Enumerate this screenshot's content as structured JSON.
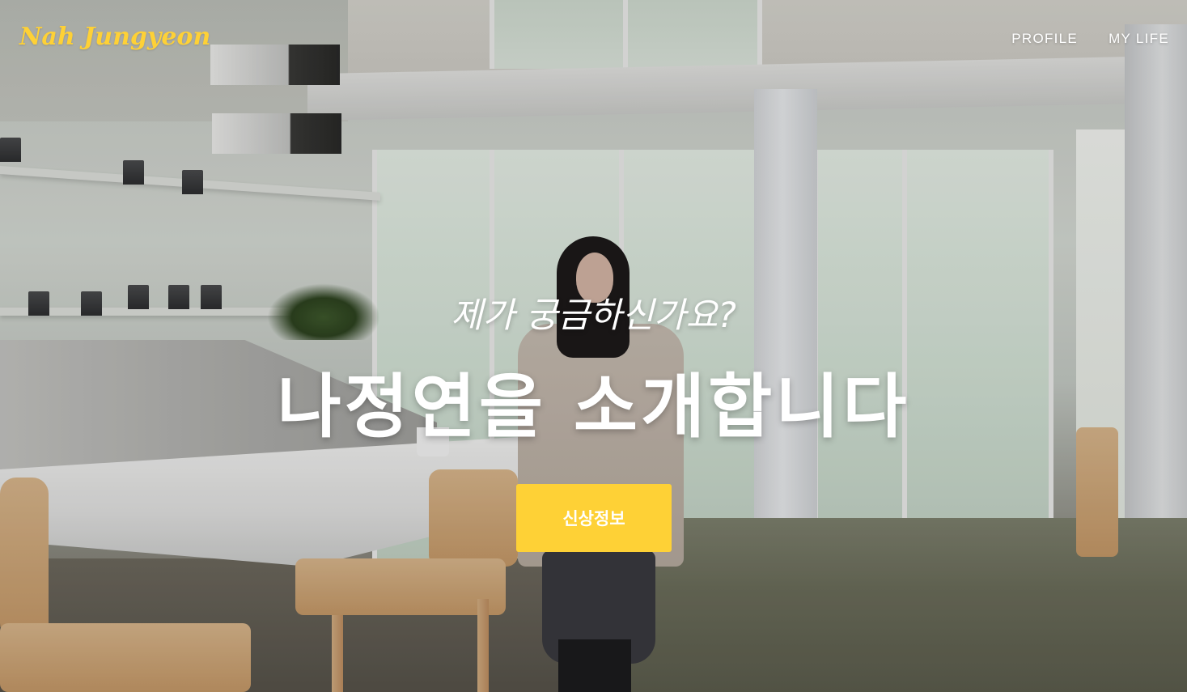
{
  "brand": {
    "name": "Nah Jungyeon"
  },
  "nav": {
    "items": [
      {
        "label": "PROFILE"
      },
      {
        "label": "MY LIFE"
      }
    ]
  },
  "hero": {
    "lead": "제가 궁금하신가요?",
    "heading": "나정연을 소개합니다",
    "button_label": "신상정보"
  },
  "colors": {
    "accent": "#fed136",
    "text": "#ffffff"
  }
}
